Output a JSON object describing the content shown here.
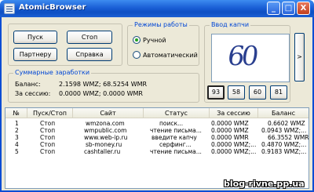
{
  "window": {
    "title": "AtomicBrowser",
    "minimize_glyph": "_",
    "maximize_glyph": "□",
    "close_glyph": "X"
  },
  "controls": {
    "start_label": "Пуск",
    "stop_label": "Стоп",
    "partner_label": "Партнеру",
    "help_label": "Справка"
  },
  "modes": {
    "title": "Режимы работы",
    "manual_label": "Ручной",
    "auto_label": "Автоматический",
    "selected": "manual"
  },
  "earnings": {
    "title": "Суммарные заработки",
    "balance_label": "Баланс:",
    "balance_value": "2.1598 WMZ; 68.5254 WMR",
    "session_label": "За сессию:",
    "session_value": "0.0000 WMZ; 0.0000 WMR"
  },
  "captcha": {
    "title": "Ввод капчи",
    "image_text": "60",
    "options": [
      "93",
      "58",
      "60",
      "81"
    ],
    "next_label": ">"
  },
  "table": {
    "columns": [
      "№",
      "Пуск/Стоп",
      "Сайт",
      "Статус",
      "За сессию",
      "Баланс"
    ],
    "rows": [
      [
        "1",
        "Стоп",
        "wmzona.com",
        "поиск...",
        "0.0000 WMZ",
        "0.6602 WMZ"
      ],
      [
        "2",
        "Стоп",
        "wmpublic.com",
        "чтение письма...",
        "0.0000 WMZ",
        "0.0943 WMZ;..."
      ],
      [
        "3",
        "Стоп",
        "www.web-ip.ru",
        "введите капчу",
        "0.0000 WMR",
        "66.3552 WMR"
      ],
      [
        "4",
        "Стоп",
        "sb-money.ru",
        "серфинг...",
        "0.0000 WMZ;...",
        "0.4870 WMZ;..."
      ],
      [
        "5",
        "Стоп",
        "cashtaller.ru",
        "чтение письма...",
        "0.0000 WMZ;...",
        "0.9183 WMZ;..."
      ]
    ]
  },
  "watermark": "blog-rivne.pp.ua"
}
